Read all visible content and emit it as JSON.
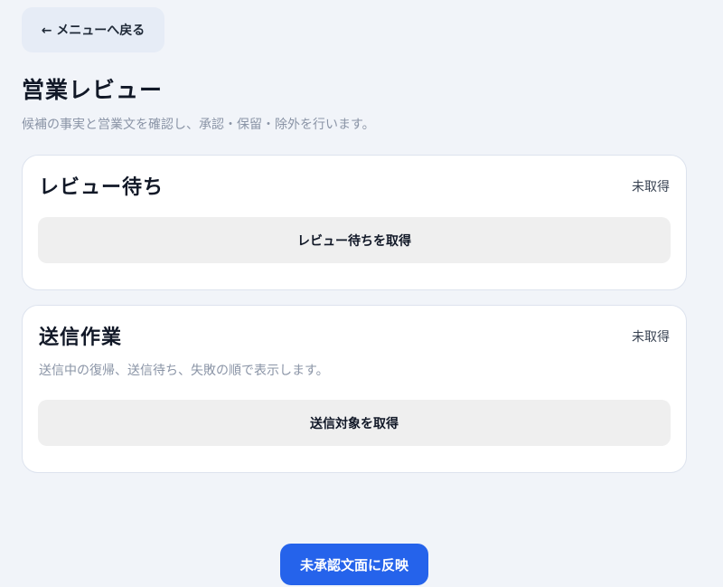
{
  "nav": {
    "back_label": "← メニューへ戻る"
  },
  "page": {
    "title": "営業レビュー",
    "subtitle": "候補の事実と営業文を確認し、承認・保留・除外を行います。"
  },
  "review_card": {
    "title": "レビュー待ち",
    "status": "未取得",
    "fetch_label": "レビュー待ちを取得"
  },
  "send_card": {
    "title": "送信作業",
    "status": "未取得",
    "description": "送信中の復帰、送信待ち、失敗の順で表示します。",
    "fetch_label": "送信対象を取得"
  },
  "footer": {
    "apply_label": "未承認文面に反映"
  },
  "colors": {
    "accent": "#2563eb",
    "background": "#f1f4f9",
    "card": "#ffffff",
    "button_secondary": "#efefef"
  }
}
